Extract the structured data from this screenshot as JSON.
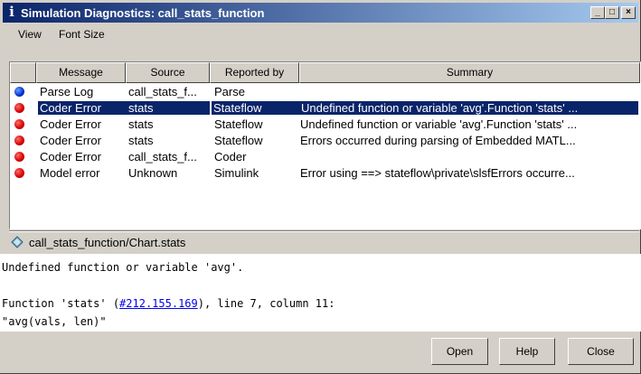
{
  "window": {
    "title": "Simulation Diagnostics: call_stats_function"
  },
  "titlebar_buttons": {
    "minimize": "_",
    "maximize": "□",
    "close": "×"
  },
  "menu": [
    {
      "label": "View"
    },
    {
      "label": "Font Size"
    }
  ],
  "table": {
    "headers": [
      "Message",
      "Source",
      "Reported by",
      "Summary"
    ],
    "rows": [
      {
        "icon": "blue",
        "message": "Parse Log",
        "source": "call_stats_f...",
        "reported_by": "Parse",
        "summary": ""
      },
      {
        "icon": "red",
        "message": "Coder Error",
        "source": "stats",
        "reported_by": "Stateflow",
        "summary": "Undefined function or variable 'avg'.Function 'stats' ...",
        "selected": true
      },
      {
        "icon": "red",
        "message": "Coder Error",
        "source": "stats",
        "reported_by": "Stateflow",
        "summary": "Undefined function or variable 'avg'.Function 'stats' ..."
      },
      {
        "icon": "red",
        "message": "Coder Error",
        "source": "stats",
        "reported_by": "Stateflow",
        "summary": "Errors occurred during parsing of Embedded MATL..."
      },
      {
        "icon": "red",
        "message": "Coder Error",
        "source": "call_stats_f...",
        "reported_by": "Coder",
        "summary": ""
      },
      {
        "icon": "red",
        "message": "Model error",
        "source": "Unknown",
        "reported_by": "Simulink",
        "summary": "Error using ==> stateflow\\private\\slsfErrors occurre..."
      }
    ]
  },
  "path": {
    "text": "call_stats_function/Chart.stats"
  },
  "message": {
    "line1": "Undefined function or variable 'avg'.",
    "line2_prefix": "Function 'stats' (",
    "line2_link": "#212.155.169",
    "line2_suffix": "), line 7, column 11:",
    "line3": "\"avg(vals, len)\""
  },
  "buttons": {
    "open": "Open",
    "help": "Help",
    "close": "Close"
  },
  "colors": {
    "title_start": "#0a246a",
    "title_end": "#a6caf0",
    "selection": "#0a246a",
    "link": "#0000ee"
  }
}
